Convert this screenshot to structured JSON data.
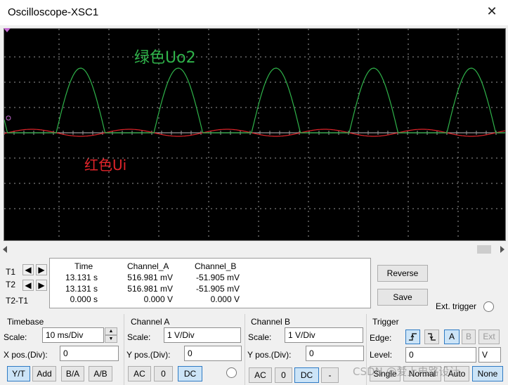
{
  "window": {
    "title": "Oscilloscope-XSC1",
    "close_glyph": "✕"
  },
  "screen": {
    "background": "#000000",
    "grid_color": "#9a9a9a",
    "channel_a_color": "#2fb34a",
    "channel_b_color": "#e0242a",
    "label_green": "绿色Uo2",
    "label_red": "红色Ui"
  },
  "cursors": {
    "t1_label": "T1",
    "t2_label": "T2",
    "diff_label": "T2-T1",
    "left_arrow": "◀",
    "right_arrow": "▶"
  },
  "readout": {
    "headers": {
      "time": "Time",
      "channel_a": "Channel_A",
      "channel_b": "Channel_B"
    },
    "rows": [
      {
        "time": "13.131 s",
        "channel_a": "516.981 mV",
        "channel_b": "-51.905 mV"
      },
      {
        "time": "13.131 s",
        "channel_a": "516.981 mV",
        "channel_b": "-51.905 mV"
      },
      {
        "time": "0.000 s",
        "channel_a": "0.000 V",
        "channel_b": "0.000 V"
      }
    ]
  },
  "side_buttons": {
    "reverse": "Reverse",
    "save": "Save",
    "ext_trigger": "Ext. trigger"
  },
  "timebase": {
    "title": "Timebase",
    "scale_label": "Scale:",
    "scale_value": "10 ms/Div",
    "xpos_label": "X pos.(Div):",
    "xpos_value": "0",
    "modes": [
      "Y/T",
      "Add",
      "B/A",
      "A/B"
    ],
    "active_mode": "Y/T"
  },
  "channel_a": {
    "title": "Channel A",
    "scale_label": "Scale:",
    "scale_value": "1  V/Div",
    "ypos_label": "Y pos.(Div):",
    "ypos_value": "0",
    "coupling": [
      "AC",
      "0",
      "DC"
    ],
    "active_coupling": "DC"
  },
  "channel_b": {
    "title": "Channel B",
    "scale_label": "Scale:",
    "scale_value": "1  V/Div",
    "ypos_label": "Y pos.(Div):",
    "ypos_value": "0",
    "coupling": [
      "AC",
      "0",
      "DC",
      "-"
    ],
    "active_coupling": "DC"
  },
  "trigger": {
    "title": "Trigger",
    "edge_label": "Edge:",
    "sources": [
      "A",
      "B",
      "Ext"
    ],
    "active_source": "A",
    "level_label": "Level:",
    "level_value": "0",
    "level_unit": "V",
    "modes": [
      "Single",
      "Normal",
      "Auto",
      "None"
    ],
    "active_mode": "None"
  },
  "watermark": "CSDN @爱上电路设计"
}
